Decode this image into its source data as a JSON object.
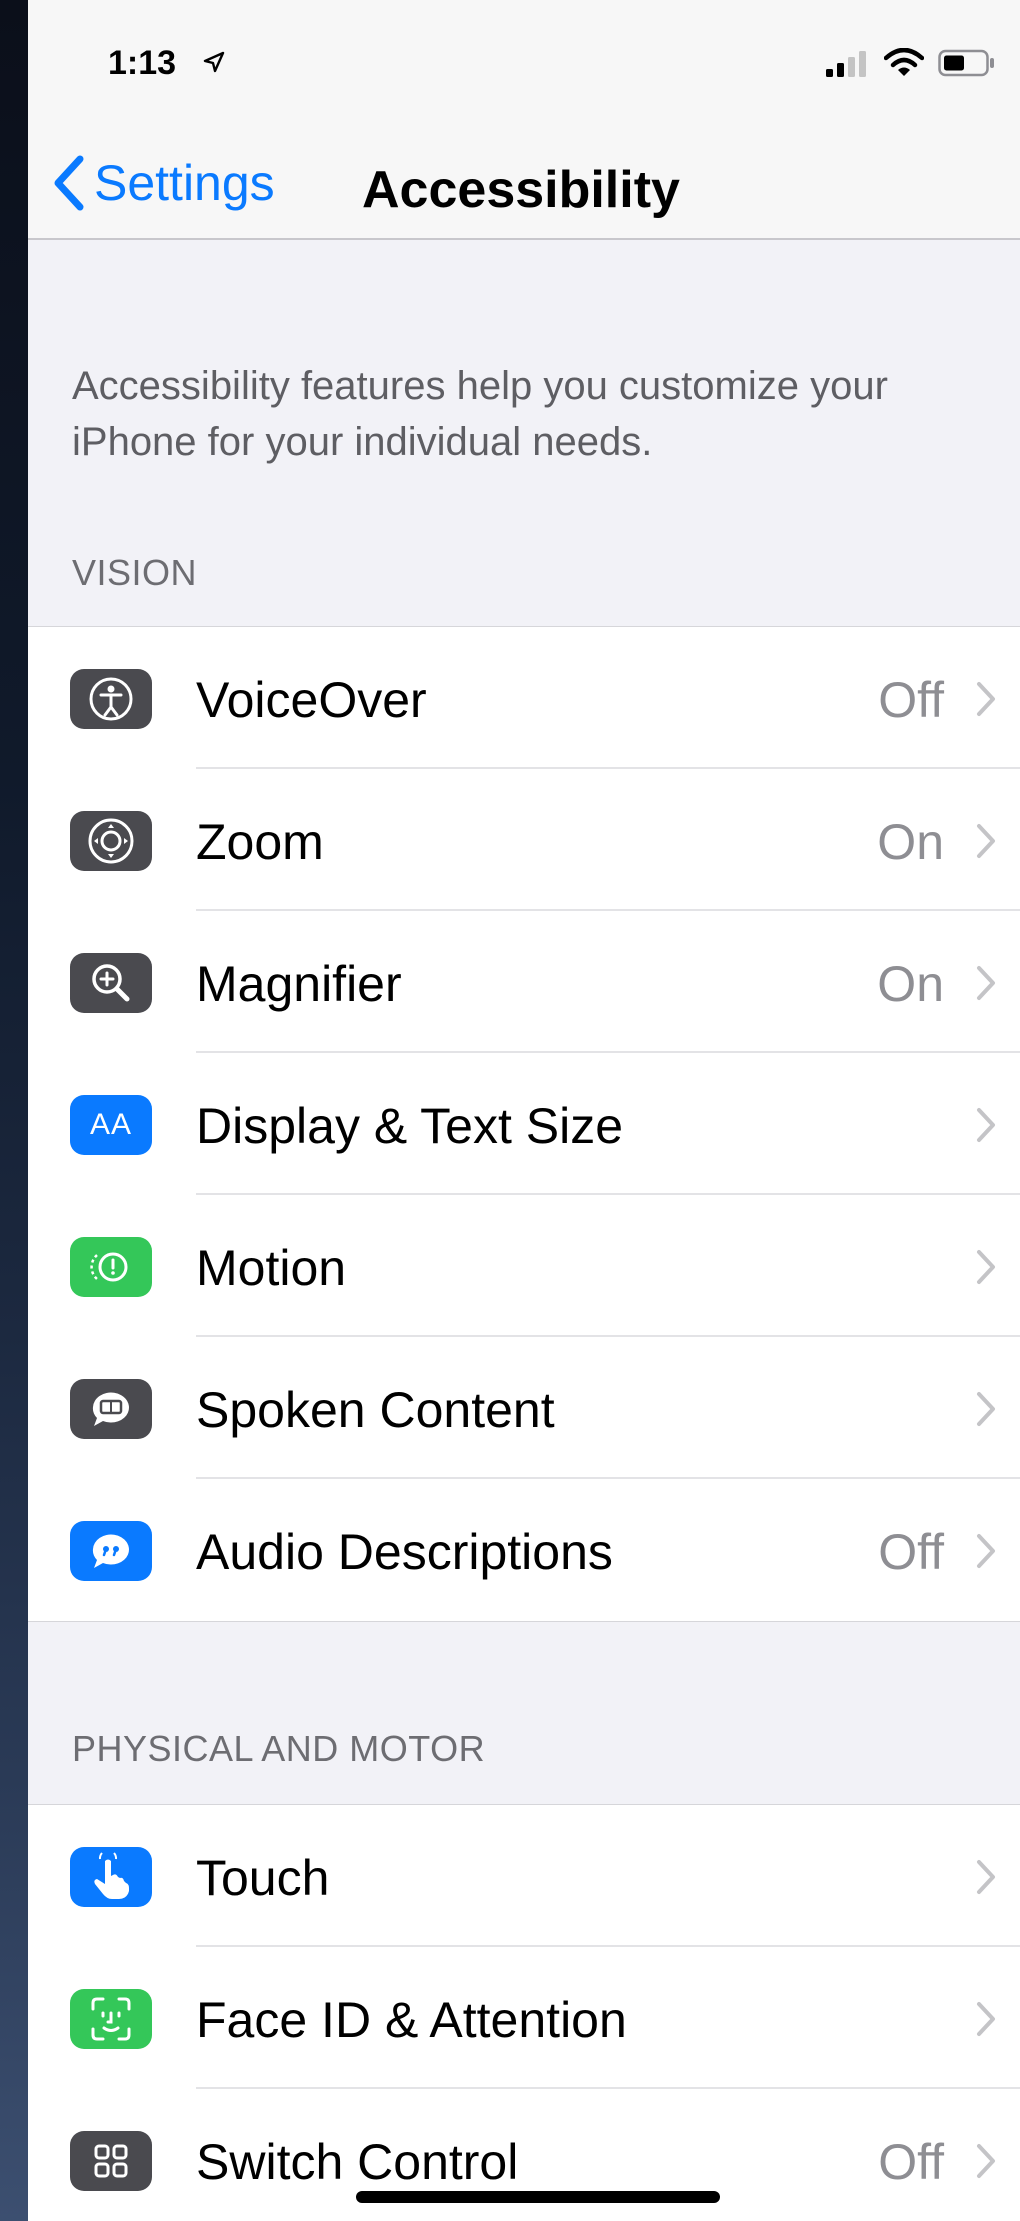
{
  "status_bar": {
    "time": "1:13"
  },
  "nav": {
    "back_label": "Settings",
    "title": "Accessibility"
  },
  "intro_text": "Accessibility features help you customize your iPhone for your individual needs.",
  "colors": {
    "accent": "#0a7aff",
    "icon_gray": "#4a4a4f",
    "icon_blue": "#0a7aff",
    "icon_green": "#34c759"
  },
  "sections": [
    {
      "header": "VISION",
      "items": [
        {
          "label": "VoiceOver",
          "value": "Off",
          "icon": "voiceover-icon"
        },
        {
          "label": "Zoom",
          "value": "On",
          "icon": "zoom-icon"
        },
        {
          "label": "Magnifier",
          "value": "On",
          "icon": "magnifier-icon"
        },
        {
          "label": "Display & Text Size",
          "value": "",
          "icon": "text-size-icon"
        },
        {
          "label": "Motion",
          "value": "",
          "icon": "motion-icon"
        },
        {
          "label": "Spoken Content",
          "value": "",
          "icon": "spoken-content-icon"
        },
        {
          "label": "Audio Descriptions",
          "value": "Off",
          "icon": "audio-descriptions-icon"
        }
      ]
    },
    {
      "header": "PHYSICAL AND MOTOR",
      "items": [
        {
          "label": "Touch",
          "value": "",
          "icon": "touch-icon"
        },
        {
          "label": "Face ID & Attention",
          "value": "",
          "icon": "face-id-icon"
        },
        {
          "label": "Switch Control",
          "value": "Off",
          "icon": "switch-control-icon"
        }
      ]
    }
  ]
}
